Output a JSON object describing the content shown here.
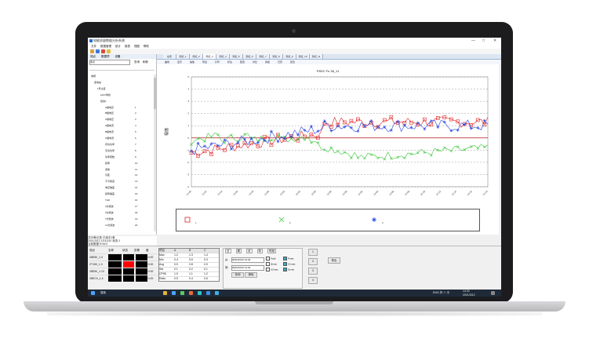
{
  "window": {
    "title": "电能质量数据分析系统",
    "controls": [
      "—",
      "□",
      "✕"
    ]
  },
  "menu": [
    "文件",
    "数据管理",
    "统计",
    "报表",
    "视图",
    "帮助"
  ],
  "toolbar_icons": [
    "open-icon",
    "save-icon",
    "settings-icon",
    "refresh-icon"
  ],
  "sidebar": {
    "tabs": [
      "测点",
      "数据项",
      "设备"
    ],
    "filter_label": "测点",
    "buttons": [
      "查询",
      "刷新"
    ],
    "tree": [
      "电网",
      "变电站",
      "1号主变",
      "10kV母线",
      "馈线1",
      "A相电压",
      "B相电压",
      "C相电压",
      "A相电流",
      "B相电流",
      "C相电流",
      "有功功率",
      "无功功率",
      "功率因数",
      "频率",
      "谐波",
      "闪变",
      "不平衡度",
      "电压偏差",
      "频率偏差",
      "THD",
      "3次谐波",
      "5次谐波",
      "7次谐波",
      "11次谐波"
    ],
    "tree_counts": [
      "1",
      "2",
      "3",
      "4",
      "5",
      "6",
      "7",
      "8",
      "9",
      "10",
      "11",
      "12",
      "13",
      "14",
      "15",
      "16",
      "17",
      "18",
      "19",
      "20"
    ],
    "status_line1": "共25条记录 已选中1条",
    "status_line2": "2021/3/12 13:41:52 状态:1",
    "status_line3": "当前数据 R:NO7"
  },
  "tabs": [
    "总览",
    "测点_1",
    "测点_2",
    "测点_3",
    "测点_4",
    "测点_5",
    "测点_6",
    "测点_7",
    "测点_8",
    "测点_9",
    "测点_10",
    "测点_11"
  ],
  "active_tab": 3,
  "chart_toolbar": [
    "曲线",
    "显示",
    "缩放",
    "导出",
    "打印",
    "标注",
    "配置",
    "对比",
    "叠加",
    "日历",
    "复位"
  ],
  "chart_data": {
    "type": "line",
    "title": "P8DC Fu 38_11",
    "ylabel": "幅值",
    "ylim": [
      -4,
      5
    ],
    "yticks": [
      "-4",
      "-3",
      "-2",
      "-1",
      "0",
      "1",
      "2",
      "3",
      "4",
      "5"
    ],
    "x_count": 90,
    "xticks": [
      "13:40",
      "13:42",
      "13:44",
      "13:46",
      "13:48",
      "13:50",
      "13:52",
      "13:54",
      "13:56",
      "13:58",
      "14:00",
      "14:02",
      "14:04",
      "14:06",
      "14:08",
      "14:10",
      "14:12",
      "14:14",
      "14:16",
      "14:18"
    ],
    "reference_line": 0,
    "series": [
      {
        "name": "1",
        "color": "#e02020",
        "marker": "square"
      },
      {
        "name": "2",
        "color": "#3cc83c",
        "marker": "x"
      },
      {
        "name": "3",
        "color": "#2040e0",
        "marker": "star"
      }
    ],
    "legend_placement": "bottom"
  },
  "bottom": {
    "table_headers": [
      "测点",
      "名称",
      "状态",
      "告警",
      "值"
    ],
    "table_rows": [
      [
        "28E50_1.3",
        "",
        "",
        "",
        "0.00"
      ],
      [
        "2T150_1.3",
        "",
        "",
        "",
        "0.00"
      ],
      [
        "28E50_1.13",
        "",
        "",
        "",
        "0.00"
      ],
      [
        "28EC0_1.4",
        "",
        "",
        "",
        "0.00"
      ]
    ],
    "row_colors": [
      "#000000",
      "#ff0000",
      "#000000",
      "#000000"
    ],
    "stats_headers": [
      "项目",
      "A",
      "B",
      "C"
    ],
    "stats_rows": [
      [
        "Max",
        "1.2",
        "1.3",
        "1.4"
      ],
      [
        "Min",
        "0.4",
        "0.5",
        "0.3"
      ],
      [
        "Avg",
        "0.9",
        "0.8",
        "0.9"
      ],
      [
        "Std",
        "0.1",
        "0.2",
        "0.1"
      ],
      [
        "CP95",
        "1.0",
        "1.1",
        "1.2"
      ],
      [
        "Ratio",
        "0.5",
        "0.4",
        "0.6"
      ]
    ],
    "query_tabs": [
      "日",
      "周",
      "月",
      "年",
      "时段"
    ],
    "time_label_from": "从",
    "time_label_to": "到",
    "time_from": "2021/03/12 13:40",
    "time_to": "2021/03/12 14:20",
    "buttons": [
      "查询",
      "清除"
    ],
    "checks": [
      "Total",
      "Pmax",
      "Qmax",
      "U1max",
      "U2max",
      "I1max"
    ],
    "side_buttons": [
      "1",
      "2",
      "3",
      "4"
    ],
    "export_button": "导出"
  },
  "taskbar": {
    "search": "搜索",
    "tray_text": "ENG 拼 ∧ 中",
    "time": "14:20",
    "date": "2021/3/12"
  }
}
